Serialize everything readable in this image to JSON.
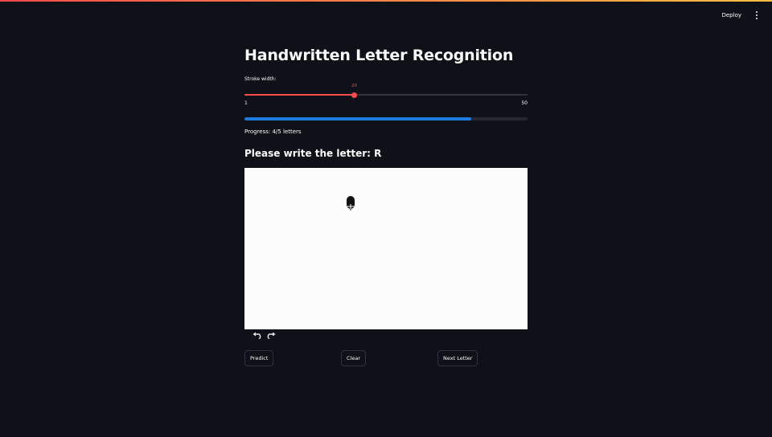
{
  "header": {
    "deploy_label": "Deploy",
    "menu_icon": "more-vertical-icon"
  },
  "main": {
    "title": "Handwritten Letter Recognition",
    "slider": {
      "label": "Stroke width:",
      "value": 20,
      "min": 1,
      "max": 50,
      "accent_color": "#ff4b4b"
    },
    "progress": {
      "fraction": 0.8,
      "text": "Progress: 4/5 letters",
      "color": "#1f7ae0"
    },
    "prompt": "Please write the letter: R",
    "canvas": {
      "background": "#fcfcfc",
      "cursor_icon": "mouse-cursor-icon"
    },
    "canvas_toolbar": {
      "undo_icon": "undo-icon",
      "redo_icon": "redo-icon"
    },
    "buttons": {
      "predict": "Predict",
      "clear": "Clear",
      "next": "Next Letter"
    }
  }
}
